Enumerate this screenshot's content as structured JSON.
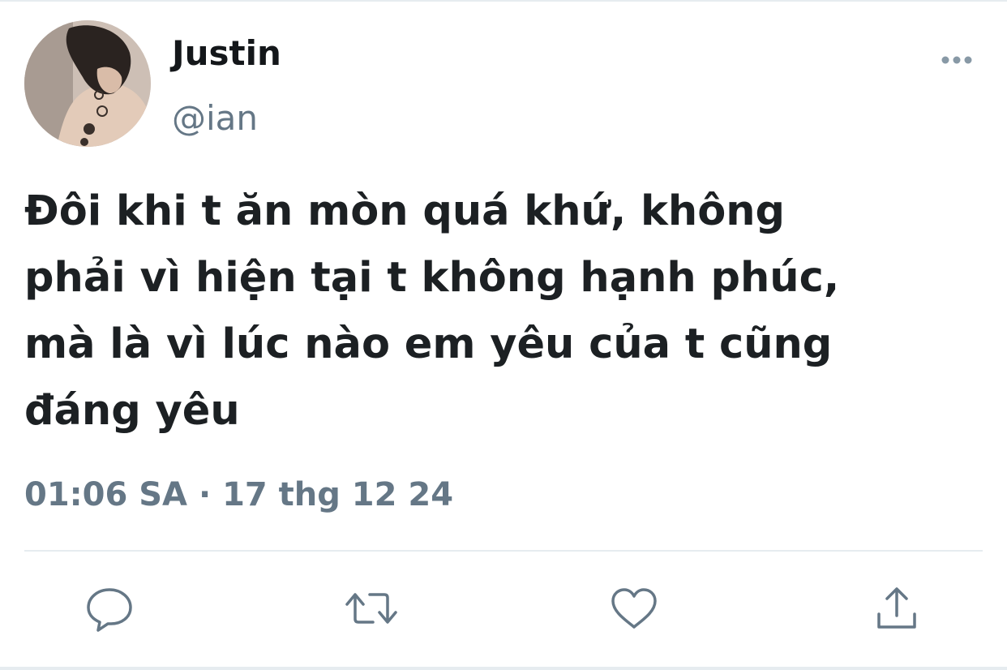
{
  "tweet": {
    "author": {
      "display_name": "Justin",
      "handle": "@ian",
      "avatar_icon": "profile-photo"
    },
    "text_lines": [
      "Đôi khi t ăn mòn quá khứ, không",
      "phải vì hiện tại t không hạnh phúc,",
      "mà là vì lúc nào em yêu của t cũng",
      "đáng yêu"
    ],
    "timestamp": "01:06 SA · 17 thg 12 24"
  },
  "actions": {
    "more_icon": "more-icon",
    "reply_icon": "reply-icon",
    "retweet_icon": "retweet-icon",
    "like_icon": "heart-icon",
    "share_icon": "share-icon"
  },
  "colors": {
    "text": "#14171a",
    "secondary": "#657786",
    "divider": "#e6ecf0"
  }
}
